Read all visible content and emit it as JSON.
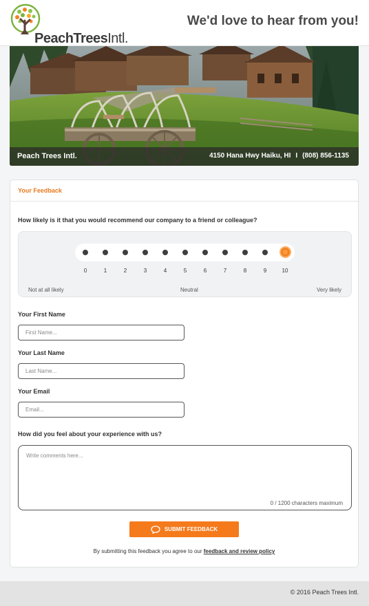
{
  "brand": {
    "logo_text_bold": "PeachTrees",
    "logo_text_light": "Intl.",
    "tagline": "We'd love to hear from you!"
  },
  "hero": {
    "business_name": "Peach Trees Intl.",
    "address": "4150 Hana Hwy Haiku, HI",
    "separator": "I",
    "phone": "(808) 856-1135"
  },
  "feedback": {
    "section_title": "Your Feedback",
    "nps_question": "How likely is it that you would recommend our company to a friend or colleague?",
    "nps_scale": [
      0,
      1,
      2,
      3,
      4,
      5,
      6,
      7,
      8,
      9,
      10
    ],
    "nps_selected": 10,
    "scale_low_label": "Not at all likely",
    "scale_mid_label": "Neutral",
    "scale_high_label": "Very likely",
    "first_name": {
      "label": "Your First Name",
      "placeholder": "First Name...",
      "value": ""
    },
    "last_name": {
      "label": "Your Last Name",
      "placeholder": "Last Name...",
      "value": ""
    },
    "email": {
      "label": "Your Email",
      "placeholder": "Email...",
      "value": ""
    },
    "experience": {
      "label": "How did you feel about your experience with us?",
      "placeholder": "Write comments here...",
      "value": ""
    },
    "char_count": "0 / 1200 characters maximum",
    "submit_label": "SUBMIT FEEDBACK",
    "agree_prefix": "By submitting this feedback you agree to our",
    "agree_link": "feedback and review policy"
  },
  "footer": {
    "copyright": "© 2016 Peach Trees Intl."
  },
  "colors": {
    "accent": "#f47a1c",
    "section_title": "#e8791d",
    "selected_dot": "#f08422"
  },
  "icons": {
    "logo": "tree-logo-icon",
    "submit": "speech-bubble-icon"
  }
}
